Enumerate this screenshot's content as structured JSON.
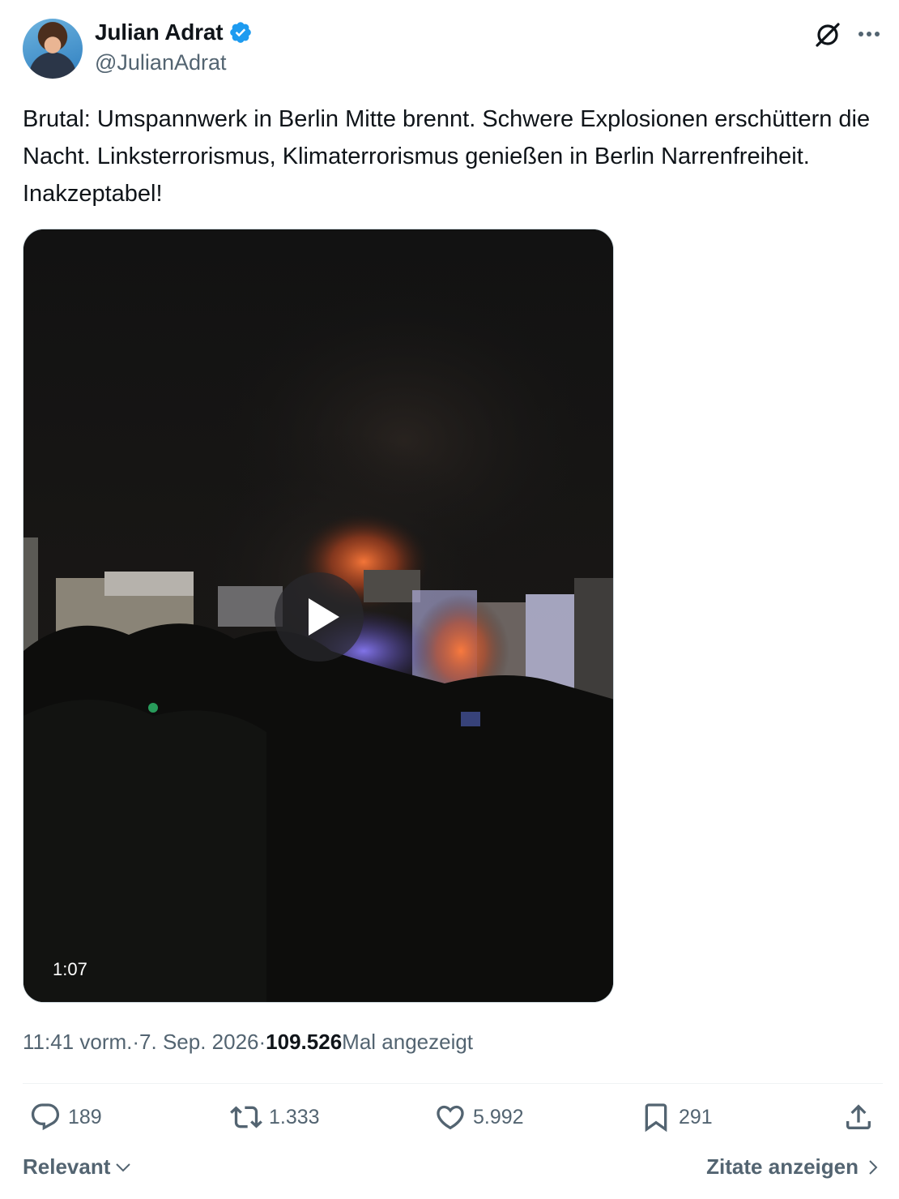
{
  "author": {
    "name": "Julian Adrat",
    "handle": "@JulianAdrat",
    "verified": true
  },
  "tweet": {
    "text": "Brutal: Umspannwerk in Berlin Mitte brennt. Schwere Explosionen erschüttern die Nacht. Linksterrorismus, Klimaterrorismus genießen in Berlin Narrenfreiheit. Inakzeptabel!"
  },
  "media": {
    "type": "video",
    "duration": "1:07",
    "icon": "play-icon"
  },
  "meta": {
    "time": "11:41 vorm.",
    "separator": " · ",
    "date": "7. Sep. 2026",
    "views_count": "109.526",
    "views_label": " Mal angezeigt"
  },
  "actions": {
    "replies": "189",
    "reposts": "1.333",
    "likes": "5.992",
    "bookmarks": "291"
  },
  "footer": {
    "sort_label": "Relevant",
    "quotes_link": "Zitate anzeigen"
  },
  "colors": {
    "verified_blue": "#1d9bf0",
    "secondary_text": "#536471",
    "primary_text": "#0f1419"
  }
}
